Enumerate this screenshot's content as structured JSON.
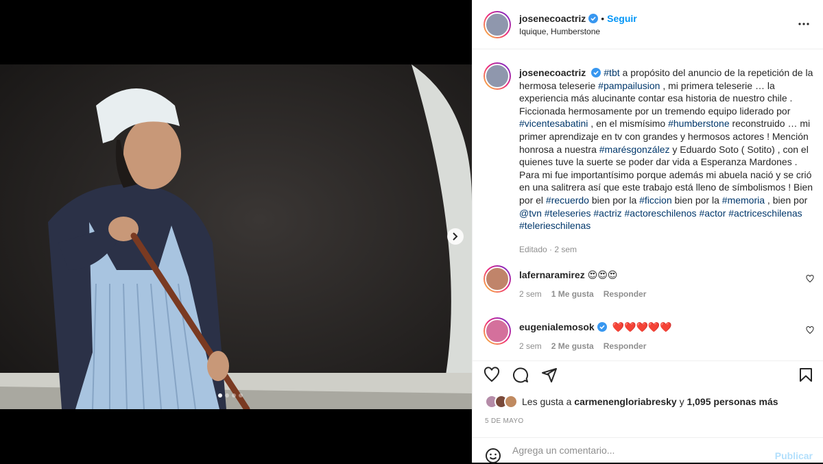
{
  "post": {
    "username": "josenecoactriz",
    "follow_label": "Seguir",
    "separator": "•",
    "location": "Iquique, Humberstone",
    "caption": {
      "parts": [
        {
          "t": "#tbt",
          "tag": true
        },
        {
          "t": " a propósito del anuncio de la repetición de la hermosa teleserie ",
          "tag": false
        },
        {
          "t": "#pampailusion",
          "tag": true
        },
        {
          "t": " , mi primera teleserie … la experiencia más alucinante contar esa historia de nuestro chile . Ficcionada hermosamente por un tremendo equipo liderado por ",
          "tag": false
        },
        {
          "t": "#vicentesabatini",
          "tag": true
        },
        {
          "t": " , en el mismísimo ",
          "tag": false
        },
        {
          "t": "#humberstone",
          "tag": true
        },
        {
          "t": " reconstruido … mi primer aprendizaje en tv con grandes y hermosos actores ! Mención honrosa a nuestra ",
          "tag": false
        },
        {
          "t": "#marésgonzález",
          "tag": true
        },
        {
          "t": " y Eduardo Soto ( Sotito) , con el quienes tuve la suerte se poder dar vida a Esperanza Mardones . Para mi fue importantísimo porque además mi abuela nació y se crió en una salitrera así que este trabajo está lleno de símbolismos ! Bien por el ",
          "tag": false
        },
        {
          "t": "#recuerdo",
          "tag": true
        },
        {
          "t": " bien por la ",
          "tag": false
        },
        {
          "t": "#ficcion",
          "tag": true
        },
        {
          "t": " bien por la ",
          "tag": false
        },
        {
          "t": "#memoria",
          "tag": true
        },
        {
          "t": " , bien por ",
          "tag": false
        },
        {
          "t": "@tvn",
          "tag": true
        },
        {
          "t": " ",
          "tag": false
        },
        {
          "t": "#teleseries",
          "tag": true
        },
        {
          "t": " ",
          "tag": false
        },
        {
          "t": "#actriz",
          "tag": true
        },
        {
          "t": " ",
          "tag": false
        },
        {
          "t": "#actoreschilenos",
          "tag": true
        },
        {
          "t": " ",
          "tag": false
        },
        {
          "t": "#actor",
          "tag": true
        },
        {
          "t": " ",
          "tag": false
        },
        {
          "t": "#actriceschilenas",
          "tag": true
        },
        {
          "t": " ",
          "tag": false
        },
        {
          "t": "#telerieschilenas",
          "tag": true
        }
      ],
      "meta": "Editado · 2 sem"
    },
    "comments": [
      {
        "username": "lafernaramirez",
        "text": "😍😍😍",
        "time": "2 sem",
        "likes": "1 Me gusta",
        "reply": "Responder",
        "verified": false
      },
      {
        "username": "eugenialemosok",
        "text": "❤️❤️❤️❤️❤️",
        "time": "2 sem",
        "likes": "2 Me gusta",
        "reply": "Responder",
        "verified": true
      }
    ],
    "likes_prefix": "Les gusta a ",
    "likes_user": "carmenengloriabresky",
    "likes_middle": " y ",
    "likes_count": "1,095 personas más",
    "date": "5 DE MAYO",
    "add_comment_placeholder": "Agrega un comentario...",
    "publish_label": "Publicar"
  },
  "colors": {
    "accent": "#0095f6",
    "hashtag": "#00376b",
    "verified": "#3897f0",
    "muted": "#8e8e8e"
  },
  "icons": [
    "verified-icon",
    "more-icon",
    "chevron-right-icon",
    "heart-icon",
    "comment-icon",
    "share-icon",
    "bookmark-icon",
    "emoji-icon"
  ]
}
